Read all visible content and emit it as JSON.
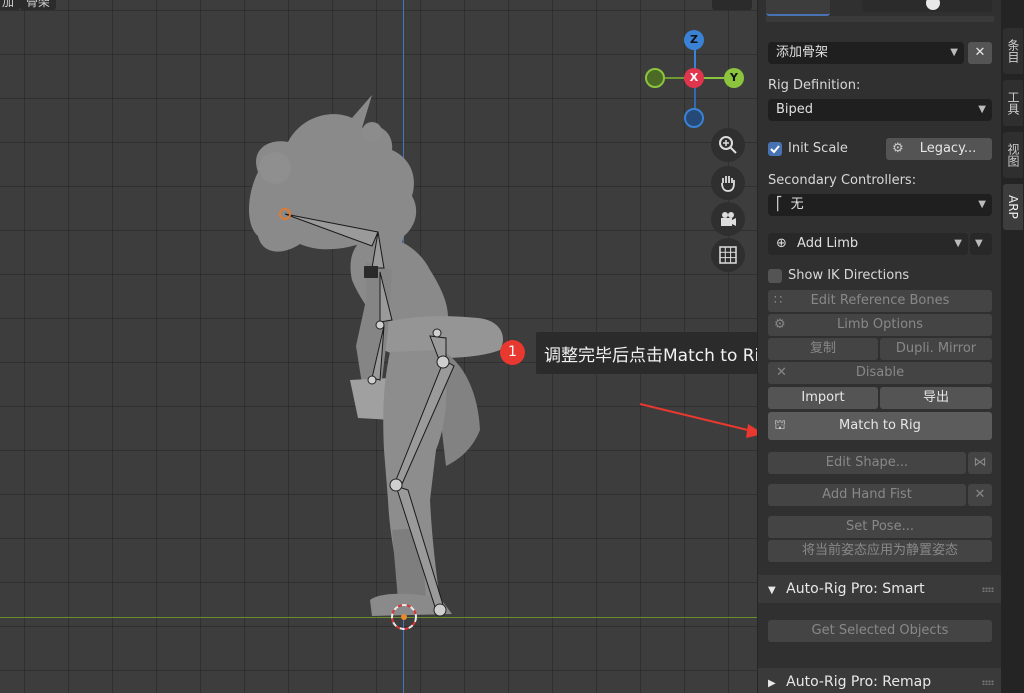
{
  "viewport_header": {
    "left_label_a": "加",
    "left_label_b": "骨架"
  },
  "gizmo": {
    "z": "Z",
    "x": "X",
    "y": "Y"
  },
  "callout": {
    "number": "1",
    "text": "调整完毕后点击Match to Rig"
  },
  "sidebar_tabs": [
    "条目",
    "工具",
    "视图",
    "ARP"
  ],
  "panel": {
    "add_rig_select": "添加骨架",
    "rig_definition_label": "Rig Definition:",
    "rig_definition_value": "Biped",
    "init_scale_label": "Init Scale",
    "init_scale_checked": true,
    "legacy_button": "Legacy...",
    "secondary_label": "Secondary Controllers:",
    "secondary_value": "无",
    "add_limb": "Add Limb",
    "show_ik_label": "Show IK Directions",
    "show_ik_checked": false,
    "edit_ref_bones": "Edit Reference Bones",
    "limb_options": "Limb Options",
    "copy_button": "复制",
    "dupli_mirror": "Dupli. Mirror",
    "disable": "Disable",
    "import": "Import",
    "export": "导出",
    "match_to_rig": "Match to Rig",
    "edit_shape": "Edit Shape...",
    "add_hand_fist": "Add Hand Fist",
    "set_pose": "Set Pose...",
    "apply_rest_pose": "将当前姿态应用为静置姿态",
    "smart_section": "Auto-Rig Pro: Smart",
    "get_selected": "Get Selected Objects",
    "remap_section": "Auto-Rig Pro: Remap"
  },
  "colors": {
    "accent_blue": "#4772b3",
    "gizmo_x": "#e0364d",
    "gizmo_y": "#8cc43e",
    "gizmo_z": "#3a82d6",
    "callout_badge": "#e8382f",
    "arrow": "#e8382f"
  }
}
